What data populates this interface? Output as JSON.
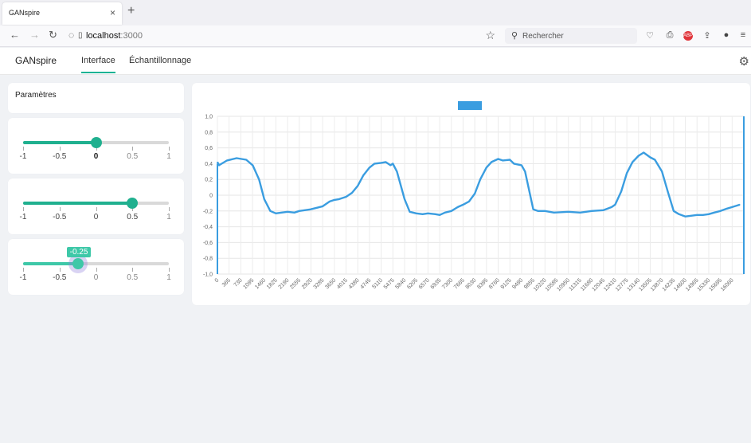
{
  "browser": {
    "tab_title": "GANspire",
    "tab_close": "×",
    "new_tab": "+",
    "url_host": "localhost",
    "url_port": ":3000",
    "search_placeholder": "Rechercher"
  },
  "app": {
    "brand": "GANspire",
    "tabs": [
      "Interface",
      "Échantillonnage"
    ],
    "active_tab": 0
  },
  "params": {
    "title": "Paramètres",
    "sliders": [
      {
        "value": 0,
        "marks": [
          "-1",
          "-0.5",
          "0",
          "0.5",
          "1"
        ],
        "strong_index": 2,
        "color": "#20b08f"
      },
      {
        "value": 0.5,
        "marks": [
          "-1",
          "-0.5",
          "0",
          "0.5",
          "1"
        ],
        "strong_index": null,
        "color": "#20b08f"
      },
      {
        "value": -0.25,
        "value_label": "-0.25",
        "marks": [
          "-1",
          "-0.5",
          "0",
          "0.5",
          "1"
        ],
        "strong_index": null,
        "color": "#3ec8a8"
      }
    ]
  },
  "chart_data": {
    "type": "line",
    "title": "",
    "xlabel": "",
    "ylabel": "",
    "ylim": [
      -1.0,
      1.0
    ],
    "y_ticks": [
      "1,0",
      "0,8",
      "0,6",
      "0,4",
      "0,2",
      "0",
      "-0,2",
      "-0,4",
      "-0,6",
      "-0,8",
      "-1,0"
    ],
    "x_ticks": [
      "0",
      "365",
      "730",
      "1095",
      "1460",
      "1825",
      "2190",
      "2555",
      "2920",
      "3285",
      "3650",
      "4015",
      "4380",
      "4745",
      "5110",
      "5475",
      "5840",
      "6205",
      "6570",
      "6935",
      "7300",
      "7665",
      "8030",
      "8395",
      "8760",
      "9125",
      "9490",
      "9855",
      "10220",
      "10585",
      "10950",
      "11315",
      "11680",
      "12045",
      "12410",
      "12775",
      "13140",
      "13505",
      "13870",
      "14235",
      "14600",
      "14965",
      "15330",
      "15695",
      "16060"
    ],
    "xlim": [
      0,
      16425
    ],
    "grid": true,
    "legend": "top-center",
    "series": [
      {
        "color": "#3a9de0",
        "x": [
          0,
          50,
          300,
          600,
          900,
          1100,
          1300,
          1460,
          1650,
          1825,
          2000,
          2190,
          2400,
          2555,
          2900,
          3285,
          3500,
          3650,
          3800,
          4015,
          4200,
          4380,
          4550,
          4745,
          4900,
          5110,
          5250,
          5400,
          5475,
          5600,
          5840,
          6000,
          6205,
          6400,
          6570,
          6800,
          6935,
          7100,
          7300,
          7500,
          7665,
          7850,
          8030,
          8200,
          8395,
          8550,
          8760,
          8900,
          9125,
          9250,
          9490,
          9600,
          9855,
          10000,
          10220,
          10500,
          10950,
          11315,
          11500,
          11680,
          12045,
          12300,
          12410,
          12600,
          12775,
          12950,
          13140,
          13300,
          13505,
          13650,
          13870,
          14050,
          14235,
          14400,
          14600,
          14800,
          14965,
          15150,
          15330,
          15500,
          15695,
          15900,
          16060,
          16300
        ],
        "y": [
          0.42,
          0.38,
          0.44,
          0.47,
          0.45,
          0.38,
          0.2,
          -0.05,
          -0.2,
          -0.23,
          -0.22,
          -0.21,
          -0.22,
          -0.2,
          -0.18,
          -0.14,
          -0.08,
          -0.06,
          -0.05,
          -0.02,
          0.03,
          0.12,
          0.25,
          0.35,
          0.4,
          0.41,
          0.42,
          0.38,
          0.4,
          0.3,
          -0.05,
          -0.21,
          -0.23,
          -0.24,
          -0.23,
          -0.24,
          -0.25,
          -0.22,
          -0.2,
          -0.15,
          -0.12,
          -0.08,
          0.02,
          0.2,
          0.35,
          0.42,
          0.46,
          0.44,
          0.45,
          0.4,
          0.38,
          0.3,
          -0.18,
          -0.2,
          -0.2,
          -0.22,
          -0.21,
          -0.22,
          -0.21,
          -0.2,
          -0.19,
          -0.15,
          -0.12,
          0.05,
          0.28,
          0.42,
          0.5,
          0.54,
          0.48,
          0.45,
          0.3,
          0.05,
          -0.2,
          -0.24,
          -0.27,
          -0.26,
          -0.25,
          -0.25,
          -0.24,
          -0.22,
          -0.2,
          -0.17,
          -0.15,
          -0.12
        ]
      }
    ]
  }
}
